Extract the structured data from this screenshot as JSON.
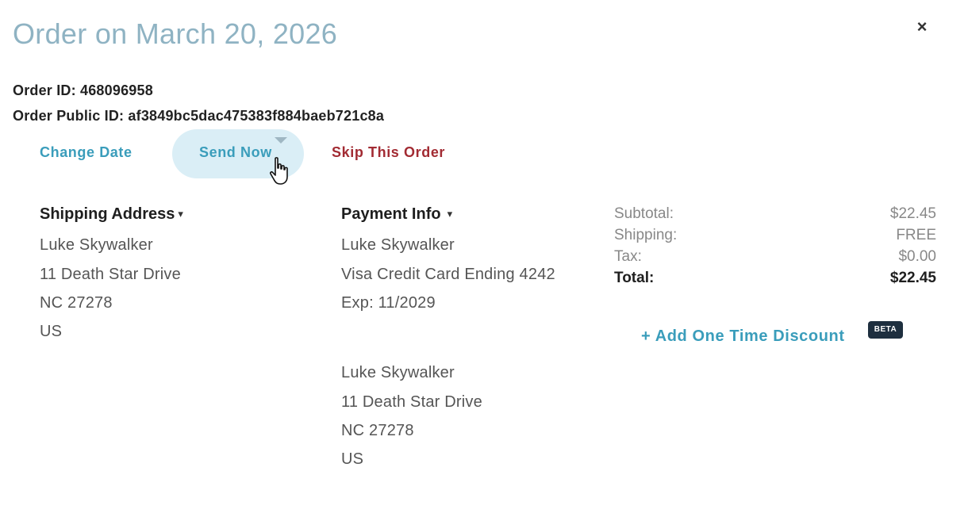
{
  "modal": {
    "title": "Order on March 20, 2026",
    "close_icon": "close-icon"
  },
  "order": {
    "id_line": "Order ID: 468096958",
    "public_id_line": "Order Public ID: af3849bc5dac475383f884baeb721c8a"
  },
  "actions": {
    "change_date": "Change Date",
    "send_now": "Send Now",
    "skip": "Skip This Order",
    "send_dropdown_icon": "caret-down-icon",
    "cursor_icon": "hand-pointer-icon"
  },
  "shipping": {
    "heading": "Shipping Address",
    "caret": "▾",
    "lines": [
      "Luke Skywalker",
      "11 Death Star Drive",
      "NC 27278",
      "US"
    ]
  },
  "payment": {
    "heading": "Payment Info",
    "caret": "▾",
    "name": "Luke Skywalker",
    "card": "Visa Credit Card Ending 4242",
    "exp": "Exp: 11/2029",
    "billing_lines": [
      "Luke Skywalker",
      "11 Death Star Drive",
      "NC 27278",
      "US"
    ]
  },
  "summary": {
    "subtotal_label": "Subtotal:",
    "subtotal_value": "$22.45",
    "shipping_label": "Shipping:",
    "shipping_value": "FREE",
    "tax_label": "Tax:",
    "tax_value": "$0.00",
    "total_label": "Total:",
    "total_value": "$22.45"
  },
  "discount": {
    "label": "+ Add One Time Discount",
    "badge": "BETA"
  },
  "colors": {
    "title": "#8fb3c3",
    "link": "#3a9dbb",
    "danger": "#a22b33",
    "pill": "#daeef6",
    "badge": "#1e2f3f"
  }
}
